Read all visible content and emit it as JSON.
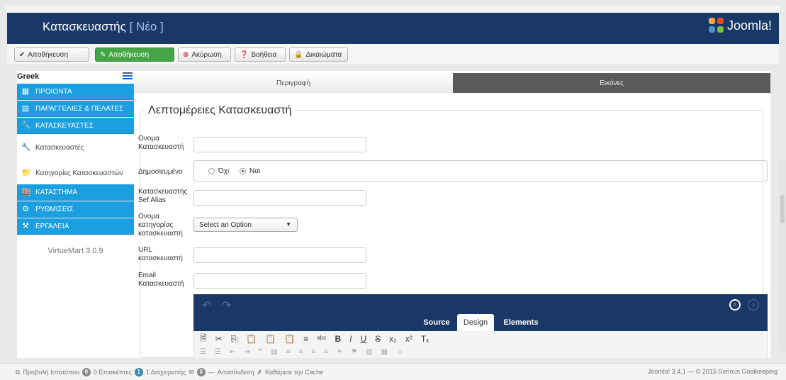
{
  "header": {
    "title": "Κατασκευαστής",
    "subtitle": "[ Νέο ]",
    "logo_text": "Joomla!"
  },
  "toolbar": {
    "save_label": "Αποθήκευση",
    "save_close_label": "Αποθήκευση",
    "cancel_label": "Ακύρωση",
    "help_label": "Βοήθεια",
    "permissions_label": "Δικαιώματα"
  },
  "sidebar": {
    "language": "Greek",
    "items": [
      {
        "label": "ΠΡΟΙΟΝΤΑ",
        "icon": "products-icon",
        "style": "blue"
      },
      {
        "label": "ΠΑΡΑΓΓΕΛΙΕΣ & ΠΕΛΑΤΕΣ",
        "icon": "orders-icon",
        "style": "blue"
      },
      {
        "label": "ΚΑΤΑΣΚΕΥΑΣΤΕΣ",
        "icon": "wrench-icon",
        "style": "blue"
      },
      {
        "label": "Κατασκευαστές",
        "icon": "wrench-icon",
        "style": "sub"
      },
      {
        "label": "Κατηγορίες Κατασκευαστών",
        "icon": "folder-icon",
        "style": "sub"
      },
      {
        "label": "ΚΑΤΑΣΤΗΜΑ",
        "icon": "store-icon",
        "style": "blue"
      },
      {
        "label": "ΡΥΘΜΙΣΕΙΣ",
        "icon": "settings-icon",
        "style": "blue"
      },
      {
        "label": "ΕΡΓΑΛΕΙΑ",
        "icon": "tools-icon",
        "style": "blue"
      }
    ],
    "version": "VirtueMart 3.0.9"
  },
  "tabs": {
    "description": "Περιγραφή",
    "images": "Εικόνες"
  },
  "form": {
    "legend": "Λεπτομέρειες Κατασκευαστή",
    "name_label_1": "Ονομα",
    "name_label_2": "Κατασκευαστή",
    "published_label": "Δημοσιευμένο",
    "radio_no": "Όχι",
    "radio_yes": "Ναι",
    "alias_label_1": "Κατασκευαστής",
    "alias_label_2": "Sef Alias",
    "category_label_1": "Ονομα",
    "category_label_2": "κατηγορίας",
    "category_label_3": "κατασκευαστή",
    "category_select": "Select an Option",
    "url_label_1": "URL",
    "url_label_2": "κατασκευαστή",
    "email_label_1": "Email",
    "email_label_2": "Κατασκευαστή",
    "name_value": "",
    "alias_value": "",
    "url_value": "",
    "email_value": ""
  },
  "editor": {
    "tab_source": "Source",
    "tab_design": "Design",
    "tab_elements": "Elements"
  },
  "statusbar": {
    "view_site": "Προβολή Ιστοτόπου",
    "visitors_count": "0",
    "visitors": "0 Επισκέπτες",
    "admins_count": "1",
    "admins": "1 Διαχειριστής",
    "messages_count": "0",
    "logout": "Αποσύνδεση",
    "clear_cache": "Καθάρισε την Cache",
    "version": "Joomla! 3.4.1 — © 2015 Serious Goalkeeping"
  }
}
